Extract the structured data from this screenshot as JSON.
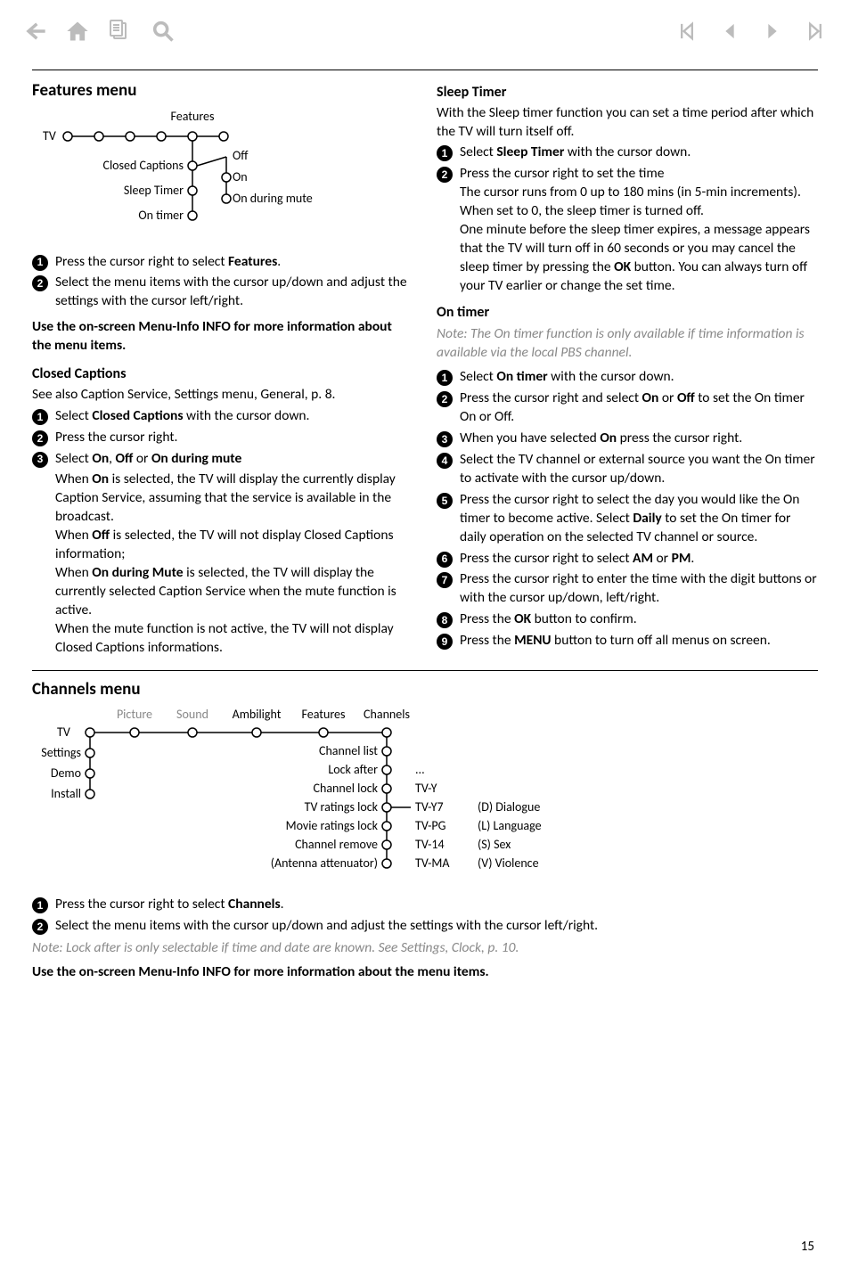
{
  "toolbar": {
    "icons": {
      "back": "back-arrow",
      "home": "home",
      "doc": "document",
      "search": "search",
      "first": "first",
      "prev": "previous",
      "next": "next",
      "last": "last"
    }
  },
  "features": {
    "title": "Features menu",
    "diagram": {
      "top": "Features",
      "left": "TV",
      "items": [
        "Closed Captions",
        "Sleep Timer",
        "On timer"
      ],
      "opts": [
        "Off",
        "On",
        "On during mute"
      ]
    },
    "steps": [
      {
        "n": "1",
        "html": "Press the cursor right to select <b>Features</b>."
      },
      {
        "n": "2",
        "html": "Select the menu items with the cursor up/down and adjust the settings with the cursor left/right."
      }
    ],
    "infoNote": "Use the on-screen Menu-Info INFO for more information about the menu items.",
    "cc": {
      "head": "Closed Captions",
      "see": "See also Caption Service, Settings menu, General, p. 8.",
      "steps": [
        {
          "n": "1",
          "html": "Select <b>Closed Captions</b> with the cursor down."
        },
        {
          "n": "2",
          "html": "Press the cursor right."
        },
        {
          "n": "3",
          "html": "Select <b>On</b>, <b>Off</b> or <b>On during mute</b>"
        }
      ],
      "detail": "When <b>On</b> is selected, the TV will display the currently display Caption Service, assuming that the service is available in the broadcast.<br>When <b>Off</b> is selected, the TV will not display Closed Captions information;<br>When <b>On during Mute</b> is selected, the TV will display the currently selected Caption Service when the mute function is active.<br>When the mute function is not active, the TV will not display Closed Captions informations."
    },
    "sleep": {
      "head": "Sleep Timer",
      "intro": "With the Sleep timer function you can set a time period after which the TV will turn itself off.",
      "steps": [
        {
          "n": "1",
          "html": "Select <b>Sleep Timer</b> with the cursor down."
        },
        {
          "n": "2",
          "html": "Press the cursor right to set the time<br>The cursor runs from 0 up to 180 mins (in 5-min increments). When set to 0, the sleep timer is turned off.<br>One minute before the sleep timer expires, a message appears that the TV will turn off in 60 seconds or you may cancel the sleep timer by pressing the <b>OK</b> button. You can always turn off your TV earlier or change the set time."
        }
      ]
    },
    "ontimer": {
      "head": "On timer",
      "note": "Note: The On timer function is only available if time information is available via the local PBS channel.",
      "steps": [
        {
          "n": "1",
          "html": "Select <b>On timer</b> with the cursor down."
        },
        {
          "n": "2",
          "html": "Press the cursor right and select <b>On</b> or <b>Off</b> to set the On timer On or Off."
        },
        {
          "n": "3",
          "html": "When you have selected <b>On</b> press the cursor right."
        },
        {
          "n": "4",
          "html": "Select the TV channel or external source you want the On timer to activate with the cursor up/down."
        },
        {
          "n": "5",
          "html": "Press the cursor right to select the day you would like the On timer to become active. Select <b>Daily</b> to set the On timer for daily operation on the selected TV channel or source."
        },
        {
          "n": "6",
          "html": "Press the cursor right to select <b>AM</b> or <b>PM</b>."
        },
        {
          "n": "7",
          "html": "Press the cursor right to enter the time with the digit buttons or with the cursor up/down, left/right."
        },
        {
          "n": "8",
          "html": "Press the <b>OK</b> button to confirm."
        },
        {
          "n": "9",
          "html": "Press the <b>MENU</b> button to turn off all menus on screen."
        }
      ]
    }
  },
  "channels": {
    "title": "Channels menu",
    "diagram": {
      "tabs": [
        "Picture",
        "Sound",
        "Ambilight",
        "Features",
        "Channels"
      ],
      "left": [
        "TV",
        "Settings",
        "Demo",
        "Install"
      ],
      "mid": [
        "Channel list",
        "Lock after",
        "Channel lock",
        "TV ratings lock",
        "Movie ratings lock",
        "Channel remove",
        "(Antenna attenuator)"
      ],
      "rightA": [
        "...",
        "TV-Y",
        "TV-Y7",
        "TV-PG",
        "TV-14",
        "TV-MA"
      ],
      "rightB": [
        "(D) Dialogue",
        "(L) Language",
        "(S) Sex",
        "(V) Violence"
      ]
    },
    "steps": [
      {
        "n": "1",
        "html": "Press the cursor right to select <b>Channels</b>."
      },
      {
        "n": "2",
        "html": "Select the menu items with the cursor up/down and adjust the settings with the cursor left/right."
      }
    ],
    "note": "Note: Lock after is only selectable if time and date are known. See Settings, Clock, p. 10.",
    "infoNote": "Use the on-screen Menu-Info INFO for more information about the menu items."
  },
  "pageNum": "15"
}
